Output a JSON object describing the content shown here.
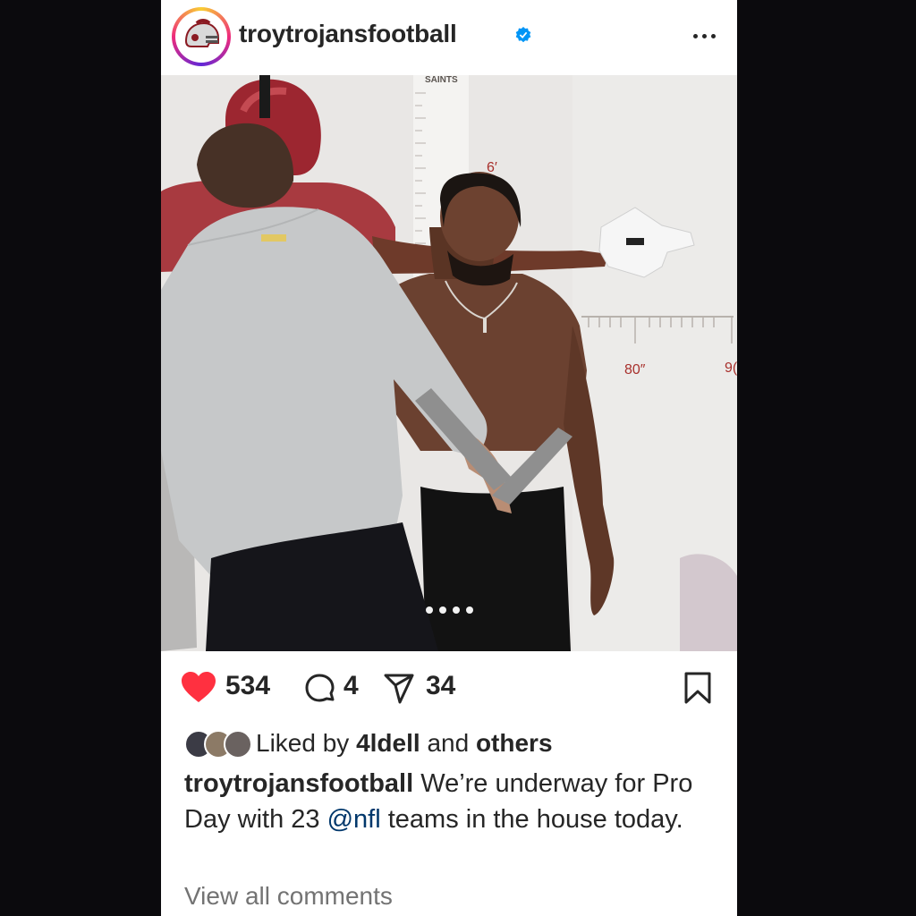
{
  "post": {
    "username": "troytrojansfootball",
    "verified": true,
    "carousel_total": 4,
    "carousel_active_index": 0,
    "image_text": {
      "chart_label": "SAINTS",
      "height_mark": "6′",
      "wingspan_80": "80″",
      "wingspan_90": "9("
    }
  },
  "actions": {
    "likes": "534",
    "comments": "4",
    "shares": "34"
  },
  "liked_by": {
    "prefix": "Liked by",
    "user": "4ldell",
    "joiner": "and",
    "others": "others"
  },
  "caption": {
    "username": "troytrojansfootball",
    "text_before": "We’re underway for Pro Day with 23",
    "mention": "@nfl",
    "text_after": "teams in the house today."
  },
  "view_all_comments": "View all comments",
  "icons": {
    "avatar": "trojan-helmet-icon",
    "verified": "verified-badge-icon",
    "more": "more-options-icon",
    "like": "heart-filled-icon",
    "comment": "comment-bubble-icon",
    "share": "paper-plane-icon",
    "save": "bookmark-icon"
  },
  "colors": {
    "like_red": "#ff3040",
    "verified_blue": "#0095f6",
    "text": "#262626",
    "muted": "#737373",
    "mention": "#00376b"
  }
}
